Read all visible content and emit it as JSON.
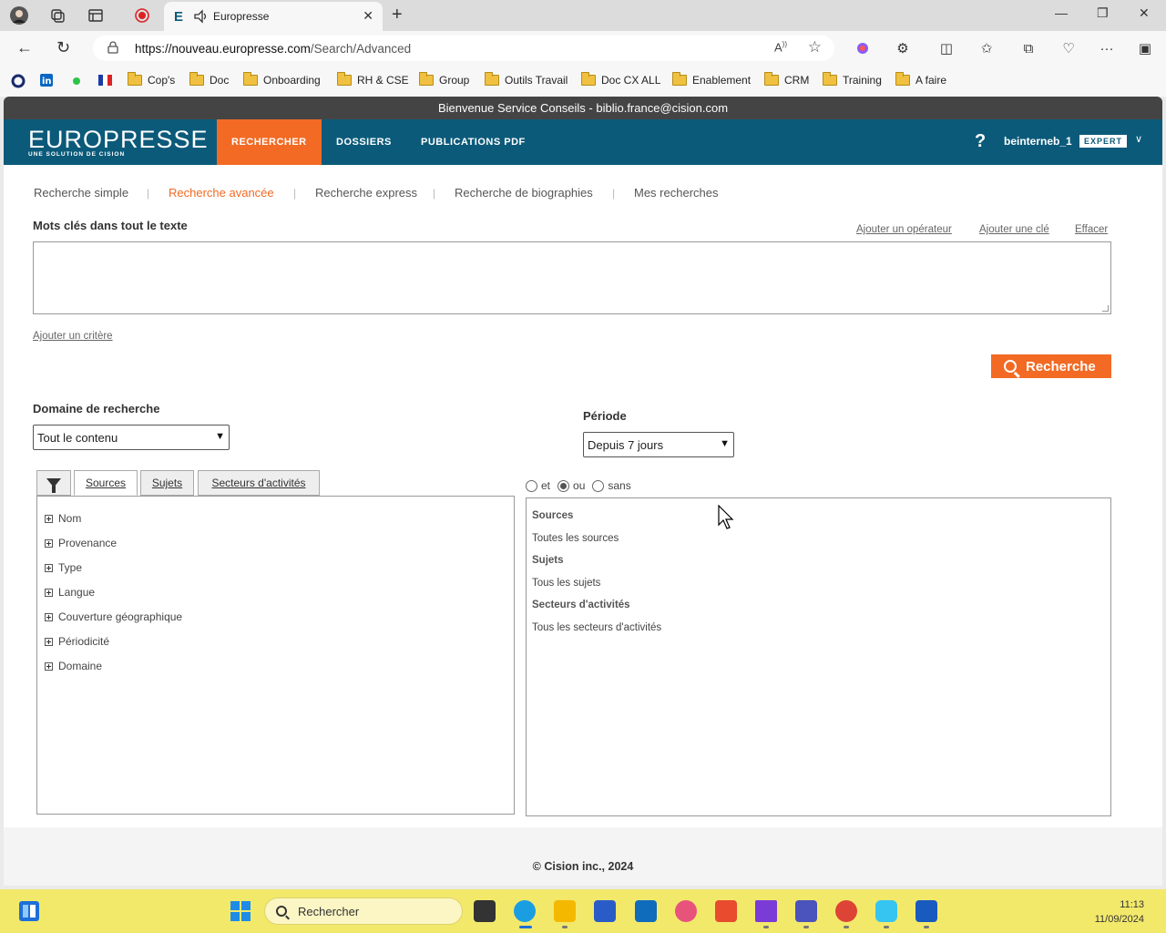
{
  "browser": {
    "tab_title": "Europresse",
    "url_host": "https://nouveau.europresse.com",
    "url_path": "/Search/Advanced",
    "bookmarks": [
      "Cop's",
      "Doc",
      "Onboarding",
      "RH & CSE",
      "Group",
      "Outils Travail",
      "Doc CX ALL",
      "Enablement",
      "CRM",
      "Training",
      "A faire"
    ]
  },
  "site": {
    "welcome": "Bienvenue Service Conseils - biblio.france@cision.com",
    "logo_main": "EUROPRESSE",
    "logo_sub": "UNE SOLUTION DE CISION",
    "nav": [
      "RECHERCHER",
      "DOSSIERS",
      "PUBLICATIONS PDF"
    ],
    "help": "?",
    "username": "beinterneb_1",
    "badge": "EXPERT"
  },
  "subnav": [
    "Recherche simple",
    "Recherche avancée",
    "Recherche express",
    "Recherche de biographies",
    "Mes recherches"
  ],
  "keywords": {
    "label": "Mots clés dans tout le texte",
    "add_operator": "Ajouter un opérateur",
    "add_key": "Ajouter une clé",
    "clear": "Effacer",
    "add_criterion": "Ajouter un critère",
    "search_button": "Recherche"
  },
  "domain": {
    "label": "Domaine de recherche",
    "selected": "Tout le contenu"
  },
  "period": {
    "label": "Période",
    "selected": "Depuis 7 jours"
  },
  "filter_tabs": [
    "Sources",
    "Sujets",
    "Secteurs d'activités"
  ],
  "tree_items": [
    "Nom",
    "Provenance",
    "Type",
    "Langue",
    "Couverture géographique",
    "Périodicité",
    "Domaine"
  ],
  "logic": {
    "options": [
      "et",
      "ou",
      "sans"
    ],
    "selected": "ou"
  },
  "summary": {
    "sources_h": "Sources",
    "sources_v": "Toutes les sources",
    "subjects_h": "Sujets",
    "subjects_v": "Tous les sujets",
    "sectors_h": "Secteurs d'activités",
    "sectors_v": "Tous les secteurs d'activités"
  },
  "footer": "© Cision inc., 2024",
  "taskbar": {
    "search": "Rechercher",
    "time": "11:13",
    "date": "11/09/2024"
  }
}
